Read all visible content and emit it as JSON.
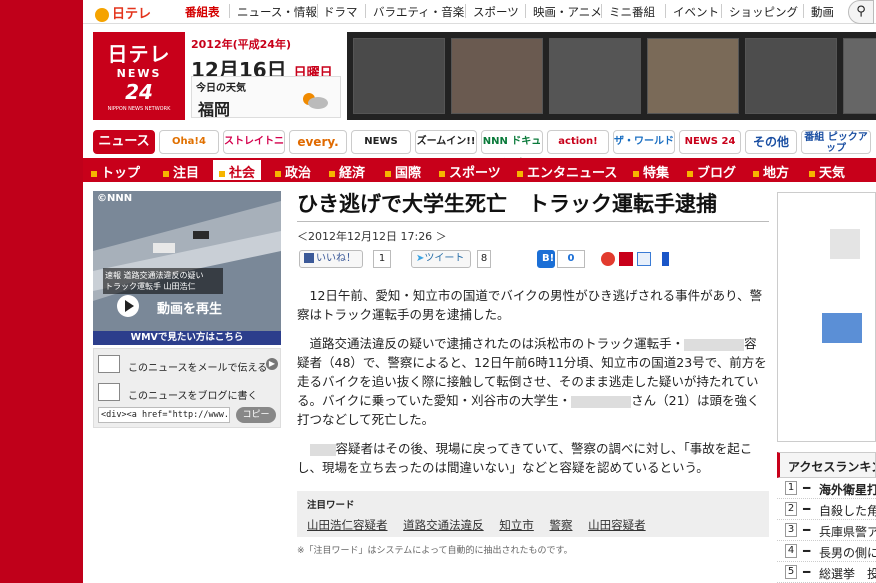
{
  "topnav": {
    "logo": "日テレ",
    "items": [
      "番組表",
      "ニュース・情報",
      "ドラマ",
      "バラエティ・音楽",
      "スポーツ",
      "映画・アニメ",
      "ミニ番組",
      "イベント",
      "ショッピング",
      "動画"
    ],
    "search_icon": "search-icon"
  },
  "header": {
    "logo_line1": "日テレ",
    "logo_line2": "NEWS",
    "logo_line3": "24",
    "logo_line4": "NIPPON NEWS NETWORK",
    "era": "2012年(平成24年)",
    "date": "12月16日",
    "weekday": "日曜日",
    "weather_label": "今日の天気",
    "city": "福岡",
    "weather_icon": "sun-cloud-icon"
  },
  "categories": [
    "ニュース",
    "Oha!4",
    "ストレイトニュース",
    "every.",
    "NEWS ZERO",
    "ズームイン!!",
    "NNN ドキュメント",
    "action!",
    "ザ・ワールド",
    "NEWS 24",
    "その他",
    "番組 ピックアップ"
  ],
  "rednav": [
    "トップ",
    "注目",
    "社会",
    "政治",
    "経済",
    "国際",
    "スポーツ",
    "エンタニュース",
    "特集",
    "ブログ",
    "地方",
    "天気"
  ],
  "video": {
    "brand": "©NNN",
    "caption_line1": "速報 道路交通法違反の疑い",
    "caption_line2": "トラック運転手 山田浩仁",
    "play_label": "動画を再生",
    "wmv_label": "WMVで見たい方はこちら"
  },
  "share": {
    "mail_label": "このニュースをメールで伝える",
    "blog_label": "このニュースをブログに書く",
    "code_value": "<div><a href=\"http://www.news",
    "copy_label": "コピー"
  },
  "article": {
    "title": "ひき逃げで大学生死亡　トラック運転手逮捕",
    "datetime": "＜2012年12月12日 17:26 ＞",
    "like_label": "いいね！",
    "like_count": "1",
    "tweet_label": "ツイート",
    "tweet_count": "8",
    "hatena_label": "B!",
    "hatena_count": "0",
    "p1": "12日午前、愛知・知立市の国道でバイクの男性がひき逃げされる事件があり、警察はトラック運転手の男を逮捕した。",
    "p2a": "道路交通法違反の疑いで逮捕されたのは浜松市のトラック運転手・",
    "p2b": "容疑者（48）で、警察によると、12日午前6時11分頃、知立市の国道23号で、前方を走るバイクを追い抜く際に接触して転倒させ、そのまま逃走した疑いが持たれている。バイクに乗っていた愛知・刈谷市の大学生・",
    "p2c": "さん（21）は頭を強く打つなどして死亡した。",
    "p3a": "容疑者はその後、現場に戻ってきていて、警察の調べに対し、「事故を起こし、現場を立ち去ったのは間違いない」などと容疑を認めているという。",
    "keyword_heading": "注目ワード",
    "keywords": [
      "山田浩仁容疑者",
      "道路交通法違反",
      "知立市",
      "警察",
      "山田容疑者"
    ],
    "note": "※「注目ワード」はシステムによって自動的に抽出されたものです。"
  },
  "access": {
    "heading": "アクセスランキング",
    "rows": [
      {
        "n": "1",
        "t": "海外衛星打"
      },
      {
        "n": "2",
        "t": "自殺した角"
      },
      {
        "n": "3",
        "t": "兵庫県警ア"
      },
      {
        "n": "4",
        "t": "長男の側に"
      },
      {
        "n": "5",
        "t": "総選挙　投"
      }
    ]
  }
}
